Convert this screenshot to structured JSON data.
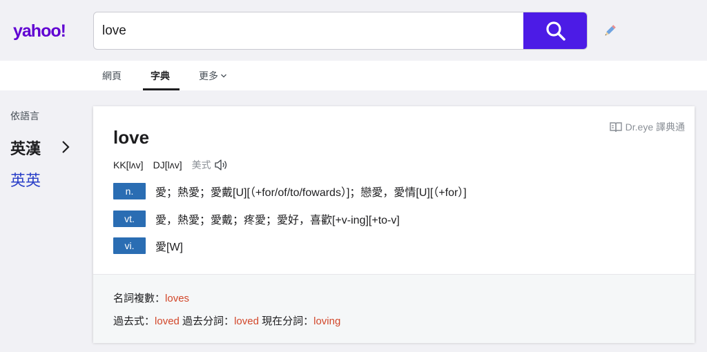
{
  "header": {
    "logo": "yahoo!",
    "search_value": "love",
    "colors": {
      "accent": "#4c1be6",
      "brand": "#6001d2"
    }
  },
  "nav": {
    "tabs": [
      {
        "label": "網頁"
      },
      {
        "label": "字典"
      },
      {
        "label": "更多"
      }
    ],
    "active_tab": "字典"
  },
  "sidebar": {
    "title": "依語言",
    "items": [
      {
        "label": "英漢"
      },
      {
        "label": "英英"
      }
    ]
  },
  "result": {
    "brand": "Dr.eye 譯典通",
    "word": "love",
    "kk": "KK[lʌv]",
    "dj": "DJ[lʌv]",
    "accent": "美式",
    "definitions": [
      {
        "pos": "n.",
        "text": "愛；熱愛；愛戴[U][（+for/of/to/fowards）]；戀愛，愛情[U][（+for）]"
      },
      {
        "pos": "vt.",
        "text": "愛，熱愛；愛戴；疼愛；愛好，喜歡[+v-ing][+to-v]"
      },
      {
        "pos": "vi.",
        "text": "愛[W]"
      }
    ],
    "inflections": {
      "plural_label": "名詞複數：",
      "plural": "loves",
      "past_label": "過去式：",
      "past": "loved",
      "pp_label": "過去分詞：",
      "pp": "loved",
      "ing_label": "現在分詞：",
      "ing": "loving"
    }
  }
}
